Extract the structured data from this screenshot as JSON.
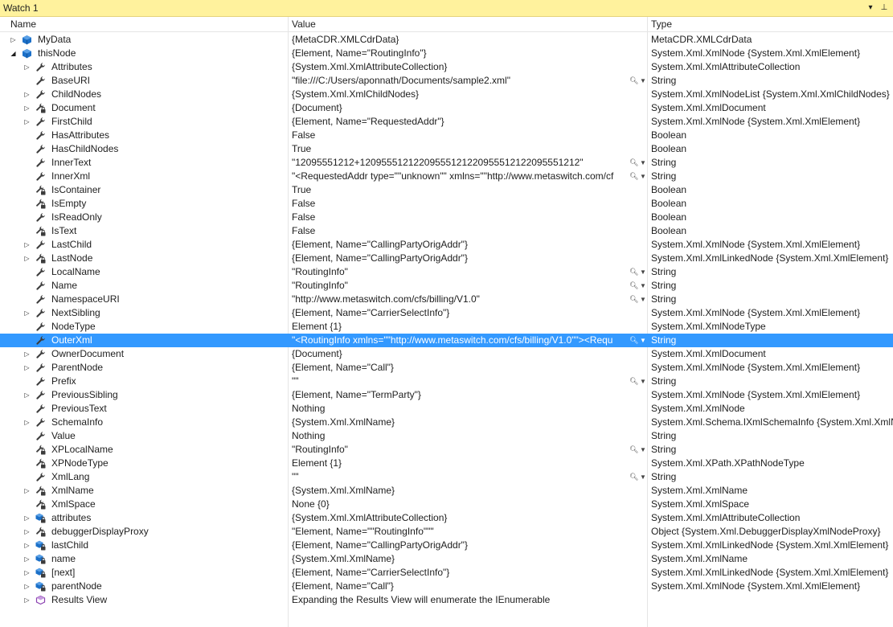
{
  "window": {
    "title": "Watch 1",
    "dropdown_icon": "▾",
    "pin_icon": "⊥"
  },
  "columns": {
    "name": "Name",
    "value": "Value",
    "type": "Type"
  },
  "rows": [
    {
      "name": "MyData",
      "value": "{MetaCDR.XMLCdrData}",
      "type": "MetaCDR.XMLCdrData",
      "level": 0,
      "expander": "collapsed",
      "icon": "cube"
    },
    {
      "name": "thisNode",
      "value": "{Element, Name=\"RoutingInfo\"}",
      "type": "System.Xml.XmlNode {System.Xml.XmlElement}",
      "level": 0,
      "expander": "expanded",
      "icon": "cube"
    },
    {
      "name": "Attributes",
      "value": "{System.Xml.XmlAttributeCollection}",
      "type": "System.Xml.XmlAttributeCollection",
      "level": 1,
      "expander": "collapsed",
      "icon": "wrench"
    },
    {
      "name": "BaseURI",
      "value": "\"file:///C:/Users/aponnath/Documents/sample2.xml\"",
      "type": "String",
      "level": 1,
      "expander": "none",
      "icon": "wrench",
      "viz": true
    },
    {
      "name": "ChildNodes",
      "value": "{System.Xml.XmlChildNodes}",
      "type": "System.Xml.XmlNodeList {System.Xml.XmlChildNodes}",
      "level": 1,
      "expander": "collapsed",
      "icon": "wrench"
    },
    {
      "name": "Document",
      "value": "{Document}",
      "type": "System.Xml.XmlDocument",
      "level": 1,
      "expander": "collapsed",
      "icon": "wrench-lock"
    },
    {
      "name": "FirstChild",
      "value": "{Element, Name=\"RequestedAddr\"}",
      "type": "System.Xml.XmlNode {System.Xml.XmlElement}",
      "level": 1,
      "expander": "collapsed",
      "icon": "wrench"
    },
    {
      "name": "HasAttributes",
      "value": "False",
      "type": "Boolean",
      "level": 1,
      "expander": "none",
      "icon": "wrench"
    },
    {
      "name": "HasChildNodes",
      "value": "True",
      "type": "Boolean",
      "level": 1,
      "expander": "none",
      "icon": "wrench"
    },
    {
      "name": "InnerText",
      "value": "\"12095551212+12095551212209555121220955512122095551212\"",
      "type": "String",
      "level": 1,
      "expander": "none",
      "icon": "wrench",
      "viz": true
    },
    {
      "name": "InnerXml",
      "value": "\"<RequestedAddr type=\"\"unknown\"\" xmlns=\"\"http://www.metaswitch.com/cf",
      "type": "String",
      "level": 1,
      "expander": "none",
      "icon": "wrench",
      "viz": true
    },
    {
      "name": "IsContainer",
      "value": "True",
      "type": "Boolean",
      "level": 1,
      "expander": "none",
      "icon": "wrench-lock"
    },
    {
      "name": "IsEmpty",
      "value": "False",
      "type": "Boolean",
      "level": 1,
      "expander": "none",
      "icon": "wrench-lock"
    },
    {
      "name": "IsReadOnly",
      "value": "False",
      "type": "Boolean",
      "level": 1,
      "expander": "none",
      "icon": "wrench"
    },
    {
      "name": "IsText",
      "value": "False",
      "type": "Boolean",
      "level": 1,
      "expander": "none",
      "icon": "wrench-lock"
    },
    {
      "name": "LastChild",
      "value": "{Element, Name=\"CallingPartyOrigAddr\"}",
      "type": "System.Xml.XmlNode {System.Xml.XmlElement}",
      "level": 1,
      "expander": "collapsed",
      "icon": "wrench"
    },
    {
      "name": "LastNode",
      "value": "{Element, Name=\"CallingPartyOrigAddr\"}",
      "type": "System.Xml.XmlLinkedNode {System.Xml.XmlElement}",
      "level": 1,
      "expander": "collapsed",
      "icon": "wrench-lock"
    },
    {
      "name": "LocalName",
      "value": "\"RoutingInfo\"",
      "type": "String",
      "level": 1,
      "expander": "none",
      "icon": "wrench",
      "viz": true
    },
    {
      "name": "Name",
      "value": "\"RoutingInfo\"",
      "type": "String",
      "level": 1,
      "expander": "none",
      "icon": "wrench",
      "viz": true
    },
    {
      "name": "NamespaceURI",
      "value": "\"http://www.metaswitch.com/cfs/billing/V1.0\"",
      "type": "String",
      "level": 1,
      "expander": "none",
      "icon": "wrench",
      "viz": true
    },
    {
      "name": "NextSibling",
      "value": "{Element, Name=\"CarrierSelectInfo\"}",
      "type": "System.Xml.XmlNode {System.Xml.XmlElement}",
      "level": 1,
      "expander": "collapsed",
      "icon": "wrench"
    },
    {
      "name": "NodeType",
      "value": "Element {1}",
      "type": "System.Xml.XmlNodeType",
      "level": 1,
      "expander": "none",
      "icon": "wrench"
    },
    {
      "name": "OuterXml",
      "value": "\"<RoutingInfo xmlns=\"\"http://www.metaswitch.com/cfs/billing/V1.0\"\"><Requ",
      "type": "String",
      "level": 1,
      "expander": "none",
      "icon": "wrench",
      "viz": true,
      "selected": true
    },
    {
      "name": "OwnerDocument",
      "value": "{Document}",
      "type": "System.Xml.XmlDocument",
      "level": 1,
      "expander": "collapsed",
      "icon": "wrench"
    },
    {
      "name": "ParentNode",
      "value": "{Element, Name=\"Call\"}",
      "type": "System.Xml.XmlNode {System.Xml.XmlElement}",
      "level": 1,
      "expander": "collapsed",
      "icon": "wrench"
    },
    {
      "name": "Prefix",
      "value": "\"\"",
      "type": "String",
      "level": 1,
      "expander": "none",
      "icon": "wrench",
      "viz": true
    },
    {
      "name": "PreviousSibling",
      "value": "{Element, Name=\"TermParty\"}",
      "type": "System.Xml.XmlNode {System.Xml.XmlElement}",
      "level": 1,
      "expander": "collapsed",
      "icon": "wrench"
    },
    {
      "name": "PreviousText",
      "value": "Nothing",
      "type": "System.Xml.XmlNode",
      "level": 1,
      "expander": "none",
      "icon": "wrench"
    },
    {
      "name": "SchemaInfo",
      "value": "{System.Xml.XmlName}",
      "type": "System.Xml.Schema.IXmlSchemaInfo {System.Xml.XmlN",
      "level": 1,
      "expander": "collapsed",
      "icon": "wrench"
    },
    {
      "name": "Value",
      "value": "Nothing",
      "type": "String",
      "level": 1,
      "expander": "none",
      "icon": "wrench"
    },
    {
      "name": "XPLocalName",
      "value": "\"RoutingInfo\"",
      "type": "String",
      "level": 1,
      "expander": "none",
      "icon": "wrench-lock",
      "viz": true
    },
    {
      "name": "XPNodeType",
      "value": "Element {1}",
      "type": "System.Xml.XPath.XPathNodeType",
      "level": 1,
      "expander": "none",
      "icon": "wrench-lock"
    },
    {
      "name": "XmlLang",
      "value": "\"\"",
      "type": "String",
      "level": 1,
      "expander": "none",
      "icon": "wrench",
      "viz": true
    },
    {
      "name": "XmlName",
      "value": "{System.Xml.XmlName}",
      "type": "System.Xml.XmlName",
      "level": 1,
      "expander": "collapsed",
      "icon": "wrench-lock"
    },
    {
      "name": "XmlSpace",
      "value": "None {0}",
      "type": "System.Xml.XmlSpace",
      "level": 1,
      "expander": "none",
      "icon": "wrench-lock"
    },
    {
      "name": "attributes",
      "value": "{System.Xml.XmlAttributeCollection}",
      "type": "System.Xml.XmlAttributeCollection",
      "level": 1,
      "expander": "collapsed",
      "icon": "field-lock"
    },
    {
      "name": "debuggerDisplayProxy",
      "value": "\"Element, Name=\"\"RoutingInfo\"\"\"",
      "type": "Object {System.Xml.DebuggerDisplayXmlNodeProxy}",
      "level": 1,
      "expander": "collapsed",
      "icon": "wrench-lock"
    },
    {
      "name": "lastChild",
      "value": "{Element, Name=\"CallingPartyOrigAddr\"}",
      "type": "System.Xml.XmlLinkedNode {System.Xml.XmlElement}",
      "level": 1,
      "expander": "collapsed",
      "icon": "field-lock"
    },
    {
      "name": "name",
      "value": "{System.Xml.XmlName}",
      "type": "System.Xml.XmlName",
      "level": 1,
      "expander": "collapsed",
      "icon": "field-lock"
    },
    {
      "name": "[next]",
      "value": "{Element, Name=\"CarrierSelectInfo\"}",
      "type": "System.Xml.XmlLinkedNode {System.Xml.XmlElement}",
      "level": 1,
      "expander": "collapsed",
      "icon": "field-lock"
    },
    {
      "name": "parentNode",
      "value": "{Element, Name=\"Call\"}",
      "type": "System.Xml.XmlNode {System.Xml.XmlElement}",
      "level": 1,
      "expander": "collapsed",
      "icon": "field-lock"
    },
    {
      "name": "Results View",
      "value": "Expanding the Results View will enumerate the IEnumerable",
      "type": "",
      "level": 1,
      "expander": "collapsed",
      "icon": "results"
    }
  ],
  "colors": {
    "title_bg": "#fff29d",
    "selection": "#3399ff",
    "grid": "#e5e5e5",
    "cube": "#1c70c8",
    "wrench": "#3c3c3c",
    "results": "#8a3fb0"
  }
}
